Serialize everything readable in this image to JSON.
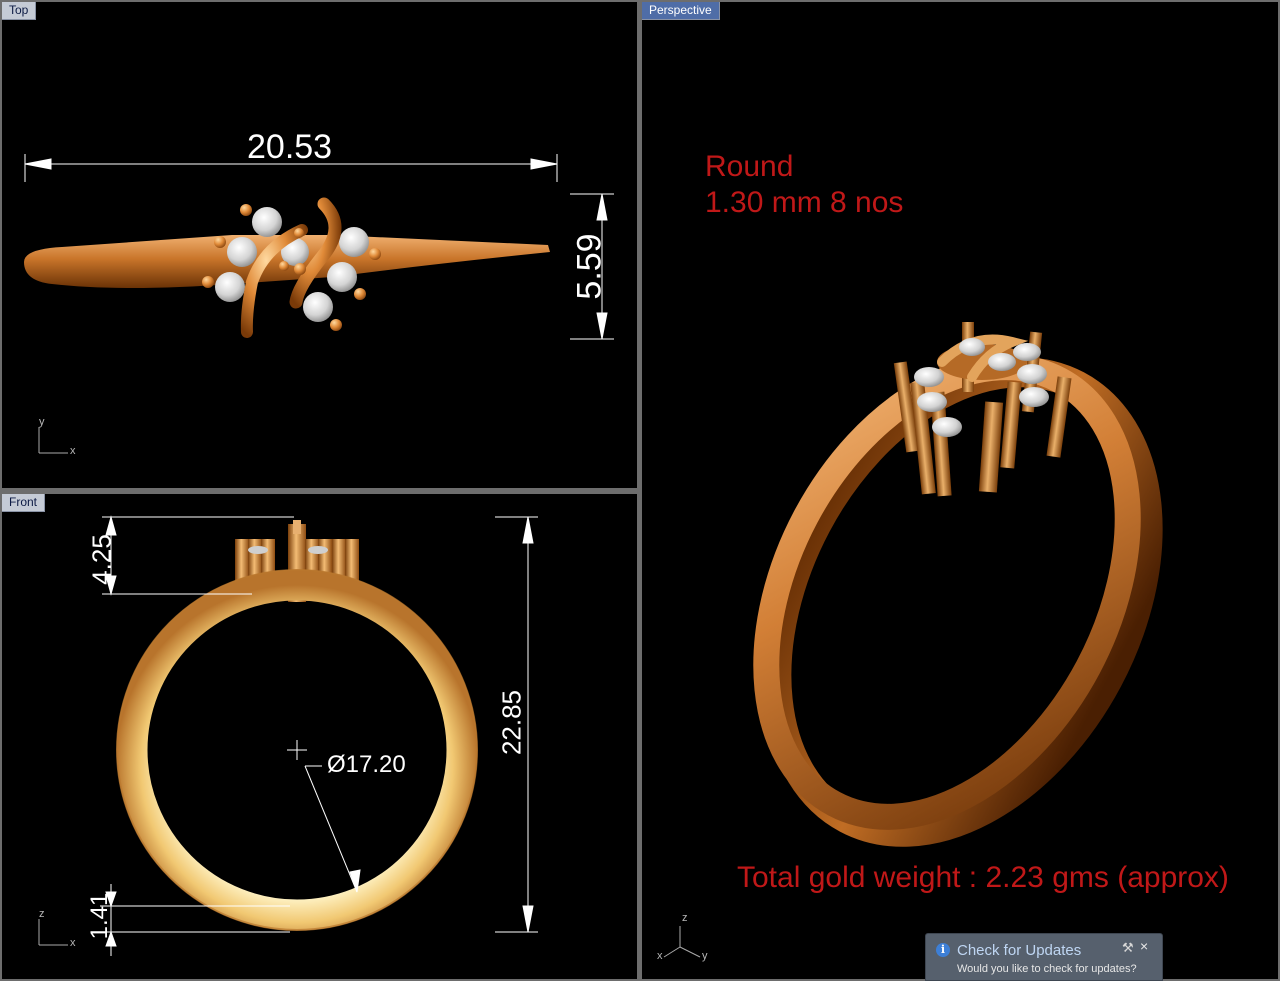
{
  "viewports": {
    "top": {
      "label": "Top",
      "axes": {
        "a": "y",
        "b": "x"
      }
    },
    "front": {
      "label": "Front",
      "axes": {
        "a": "z",
        "b": "x"
      }
    },
    "perspective": {
      "label": "Perspective",
      "axes": {
        "z": "z",
        "x": "x",
        "y": "y"
      }
    }
  },
  "dimensions": {
    "top_width": "20.53",
    "top_height": "5.59",
    "front_head_height": "4.25",
    "front_total_height": "22.85",
    "front_diameter": "Ø17.20",
    "front_shank_thickness": "1.41"
  },
  "notes": {
    "stone_shape": "Round",
    "stone_detail": "1.30 mm 8 nos",
    "gold_weight": "Total gold weight : 2.23 gms (approx)"
  },
  "update_popup": {
    "title": "Check for Updates",
    "message": "Would you like to check for updates?",
    "info_icon": "i",
    "close_icon": "×",
    "pin_icon": "⚒"
  },
  "colors": {
    "viewport_bg": "#000000",
    "active_tab": "#4f6da7",
    "inactive_tab": "#c5cbd6",
    "gold": "#d98a3a",
    "note_red": "#c01818"
  }
}
